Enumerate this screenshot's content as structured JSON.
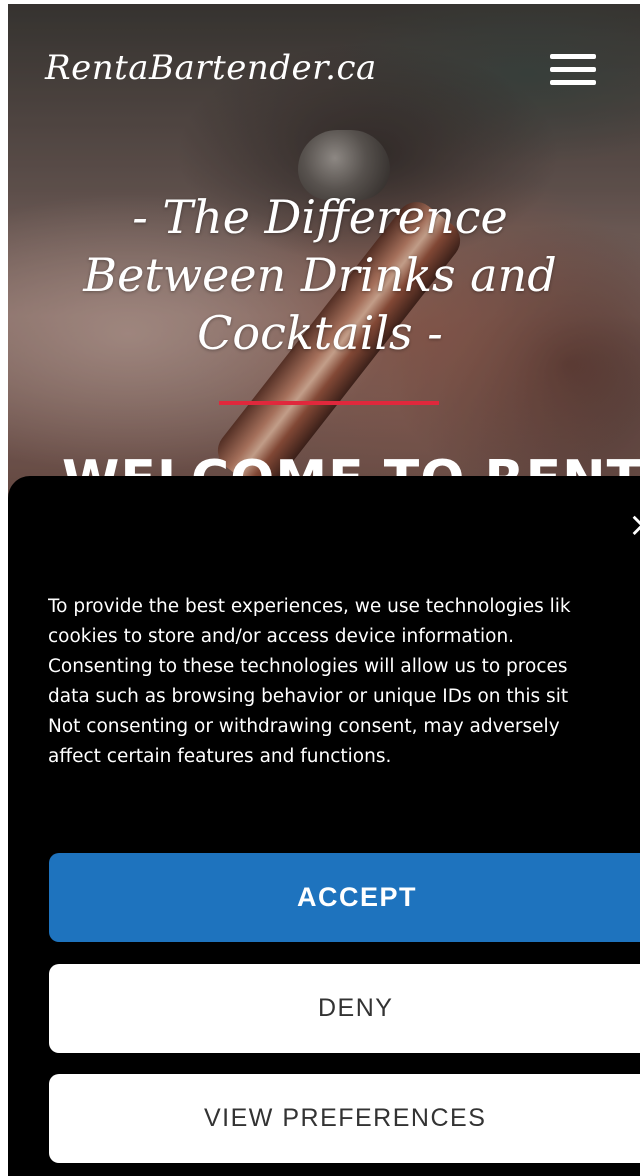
{
  "header": {
    "logo_text": "RentaBartender.ca",
    "menu_icon": "hamburger-menu-icon"
  },
  "hero": {
    "headline_lines": [
      "- The Difference",
      "Between Drinks and",
      "Cocktails -"
    ],
    "welcome_text": "WELCOME TO RENT",
    "accent_color": "#e0283c"
  },
  "consent": {
    "close_label": "×",
    "text_lines": [
      "To provide the best experiences, we use technologies lik",
      "cookies to store and/or access device information.",
      "Consenting to these technologies will allow us to proces",
      "data such as browsing behavior or unique IDs on this sit",
      "Not consenting or withdrawing consent, may adversely",
      "affect certain features and functions."
    ],
    "accept_label": "ACCEPT",
    "deny_label": "DENY",
    "preferences_label": "VIEW PREFERENCES",
    "accept_color": "#1e73be"
  }
}
